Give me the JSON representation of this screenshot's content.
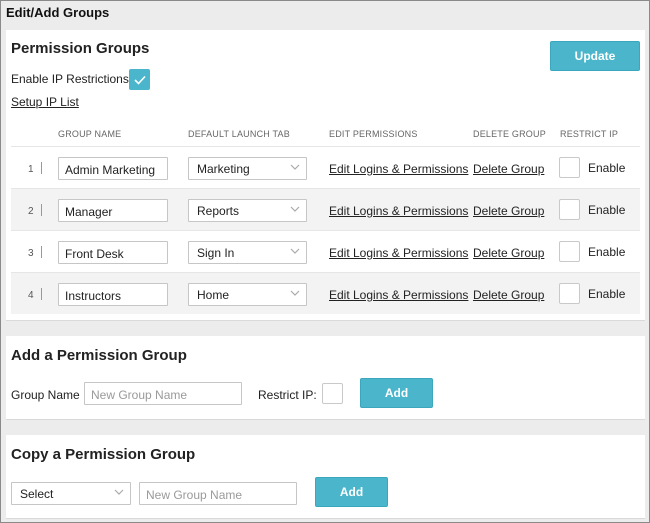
{
  "window_title": "Edit/Add Groups",
  "groups_panel": {
    "heading": "Permission Groups",
    "update_label": "Update",
    "ip_restrictions_label": "Enable IP Restrictions",
    "ip_restrictions_checked": true,
    "setup_ip_link": "Setup IP List",
    "columns": [
      "GROUP NAME",
      "DEFAULT LAUNCH TAB",
      "EDIT PERMISSIONS",
      "DELETE GROUP",
      "RESTRICT IP"
    ],
    "rows": [
      {
        "num": "1",
        "name": "Admin Marketing",
        "tab": "Marketing",
        "edit": "Edit Logins & Permissions",
        "delete": "Delete Group",
        "enable": "Enable"
      },
      {
        "num": "2",
        "name": "Manager",
        "tab": "Reports",
        "edit": "Edit Logins & Permissions",
        "delete": "Delete Group",
        "enable": "Enable"
      },
      {
        "num": "3",
        "name": "Front Desk",
        "tab": "Sign In",
        "edit": "Edit Logins & Permissions",
        "delete": "Delete Group",
        "enable": "Enable"
      },
      {
        "num": "4",
        "name": "Instructors",
        "tab": "Home",
        "edit": "Edit Logins & Permissions",
        "delete": "Delete Group",
        "enable": "Enable"
      }
    ]
  },
  "add_panel": {
    "heading": "Add a Permission Group",
    "group_name_label": "Group Name",
    "group_name_placeholder": "New Group Name",
    "restrict_ip_label": "Restrict IP:",
    "add_label": "Add"
  },
  "copy_panel": {
    "heading": "Copy a Permission Group",
    "select_value": "Select",
    "group_name_placeholder": "New Group Name",
    "add_label": "Add"
  },
  "colors": {
    "accent": "#4bb6cb",
    "row_alt": "#f3f3f3"
  },
  "icons": {
    "check": "check-icon",
    "dropdown": "chevron-down-icon"
  }
}
